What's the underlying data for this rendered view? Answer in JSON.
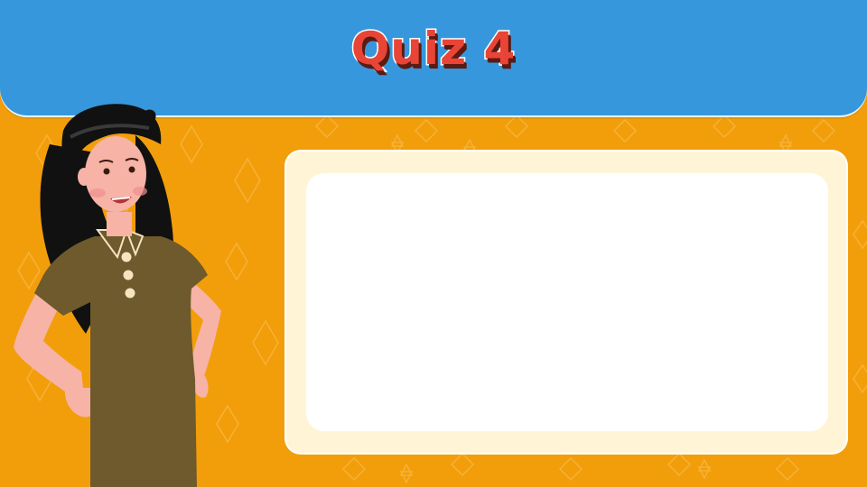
{
  "header": {
    "title": "Quiz 4"
  },
  "colors": {
    "background": "#F29E0B",
    "banner": "#3797DC",
    "title": "#E84537",
    "card_frame": "#FFF5D6",
    "card_body": "#FFFFFF",
    "dress": "#6E5A2C"
  },
  "card": {
    "text": ""
  },
  "illustration": {
    "icon": "teacher-illustration"
  }
}
